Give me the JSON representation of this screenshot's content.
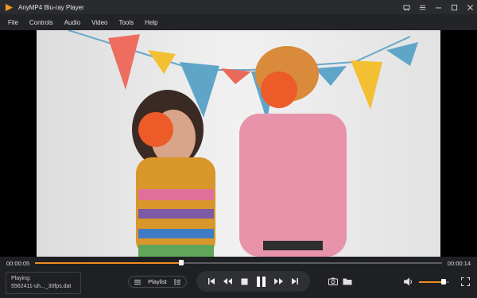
{
  "window": {
    "title": "AnyMP4 Blu-ray Player"
  },
  "menu": [
    "File",
    "Controls",
    "Audio",
    "Video",
    "Tools",
    "Help"
  ],
  "playback": {
    "current_time": "00:00:05",
    "total_time": "00:00:14",
    "progress_fraction": 0.36
  },
  "now_playing": {
    "label": "Playing:",
    "file": "5562411-uh..._30fps.dat"
  },
  "playlist": {
    "label": "Playlist"
  },
  "volume": {
    "level_fraction": 0.82
  },
  "colors": {
    "accent": "#ef8b1f",
    "background": "#1f2023"
  },
  "icons": {
    "logo": "play-logo-icon",
    "titlebar": [
      "cart-icon",
      "menu-icon",
      "minimize-icon",
      "maximize-icon",
      "close-icon"
    ],
    "transport": [
      "skip-previous-icon",
      "rewind-icon",
      "stop-icon",
      "pause-icon",
      "fast-forward-icon",
      "skip-next-icon"
    ],
    "tools": [
      "snapshot-icon",
      "folder-icon",
      "volume-icon",
      "fullscreen-icon"
    ]
  }
}
